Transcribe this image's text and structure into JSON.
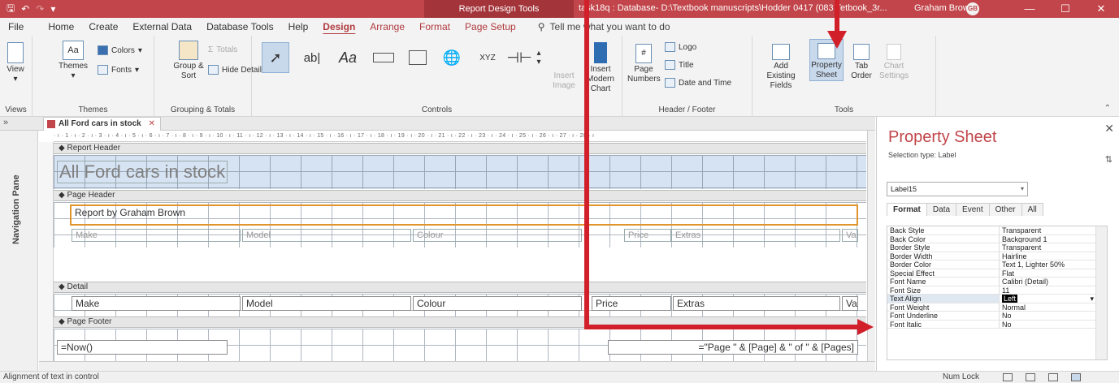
{
  "titlebar": {
    "context_tab": "Report Design Tools",
    "file_title": "task18q : Database- D:\\Textbook manuscripts\\Hodder 0417 (083 Tetbook_3r...",
    "user_name": "Graham Brown",
    "user_initials": "GB",
    "minimize": "—",
    "restore": "☐",
    "close": "✕"
  },
  "tabs": [
    "File",
    "Home",
    "Create",
    "External Data",
    "Database Tools",
    "Help",
    "Design",
    "Arrange",
    "Format",
    "Page Setup"
  ],
  "active_tab": "Design",
  "tell_me": "Tell me what you want to do",
  "ribbon": {
    "views": {
      "label": "Views",
      "view_button": "View"
    },
    "themes": {
      "label": "Themes",
      "themes_button": "Themes",
      "colors": "Colors",
      "fonts": "Fonts"
    },
    "grouping": {
      "label": "Grouping & Totals",
      "group_sort": "Group & Sort",
      "totals": "Totals",
      "hide_details": "Hide Details"
    },
    "controls": {
      "label": "Controls",
      "insert_image": "Insert Image",
      "insert_chart": "Insert Modern Chart",
      "textbox": "ab|",
      "label_ctrl": "Aa",
      "xyz": "XYZ"
    },
    "header_footer": {
      "label": "Header / Footer",
      "page_numbers": "Page Numbers",
      "logo": "Logo",
      "title": "Title",
      "date_time": "Date and Time"
    },
    "tools": {
      "label": "Tools",
      "add_fields": "Add Existing Fields",
      "property_sheet": "Property Sheet",
      "tab_order": "Tab Order",
      "chart_settings": "Chart Settings"
    }
  },
  "document": {
    "tab_title": "All Ford cars in stock",
    "nav_pane_label": "Navigation Pane",
    "ruler_text": "· ı · 1 · ı · 2 · ı · 3 · ı · 4 · ı · 5 · ı · 6 · ı · 7 · ı · 8 · ı · 9 · ı · 10 · ı · 11 · ı · 12 · ı · 13 · ı · 14 · ı · 15 · ı · 16 · ı · 17 · ı · 18 · ı · 19 · ı · 20 · ı · 21 · ı · 22 · ı · 23 · ı · 24 · ı · 25 · ı · 26 · ı · 27 · ı · 28 · ı",
    "sections": {
      "report_header": "Report Header",
      "page_header": "Page Header",
      "detail": "Detail",
      "page_footer": "Page Footer"
    },
    "report_title": "All Ford cars in stock",
    "page_header_label": "Report by Graham Brown",
    "header_labels": [
      "Make",
      "Model",
      "Colour",
      "Price",
      "Extras",
      "Va"
    ],
    "detail_fields": [
      "Make",
      "Model",
      "Colour",
      "Price",
      "Extras",
      "Va"
    ],
    "footer_left": "=Now()",
    "footer_right": "=\"Page \" & [Page] & \" of \" & [Pages]"
  },
  "property_sheet": {
    "title": "Property Sheet",
    "selection_type": "Selection type:  Label",
    "selected_control": "Label15",
    "tabs": [
      "Format",
      "Data",
      "Event",
      "Other",
      "All"
    ],
    "active_tab": "Format",
    "rows": [
      {
        "name": "Back Style",
        "value": "Transparent"
      },
      {
        "name": "Back Color",
        "value": "Background 1"
      },
      {
        "name": "Border Style",
        "value": "Transparent"
      },
      {
        "name": "Border Width",
        "value": "Hairline"
      },
      {
        "name": "Border Color",
        "value": "Text 1, Lighter 50%"
      },
      {
        "name": "Special Effect",
        "value": "Flat"
      },
      {
        "name": "Font Name",
        "value": "Calibri (Detail)"
      },
      {
        "name": "Font Size",
        "value": "11"
      },
      {
        "name": "Text Align",
        "value": "Left"
      },
      {
        "name": "Font Weight",
        "value": "Normal"
      },
      {
        "name": "Font Underline",
        "value": "No"
      },
      {
        "name": "Font Italic",
        "value": "No"
      }
    ],
    "selected_row": "Text Align"
  },
  "status": {
    "left": "Alignment of text in control",
    "num_lock": "Num Lock"
  },
  "colors": {
    "accent": "#c1454a",
    "annotation": "#d2202b"
  }
}
